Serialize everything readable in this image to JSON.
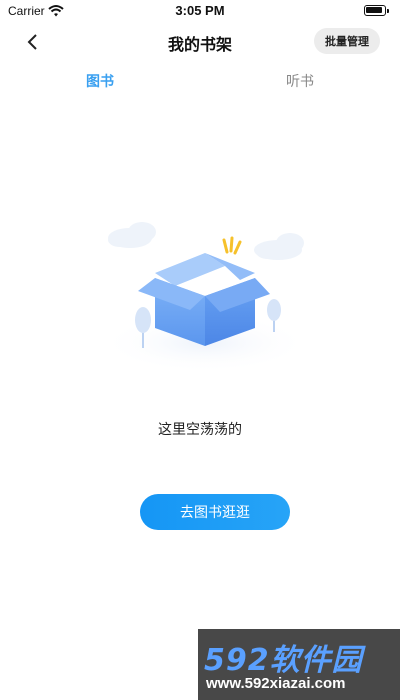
{
  "status_bar": {
    "carrier": "Carrier",
    "time": "3:05 PM"
  },
  "nav": {
    "title": "我的书架",
    "batch_manage_label": "批量管理"
  },
  "tabs": [
    {
      "label": "图书",
      "active": true
    },
    {
      "label": "听书",
      "active": false
    }
  ],
  "empty_state": {
    "message": "这里空荡荡的",
    "button_label": "去图书逛逛"
  },
  "watermark": {
    "brand": "592软件园",
    "url": "www.592xiazai.com"
  },
  "colors": {
    "accent": "#3aa0f0",
    "button": "#1596f5"
  }
}
